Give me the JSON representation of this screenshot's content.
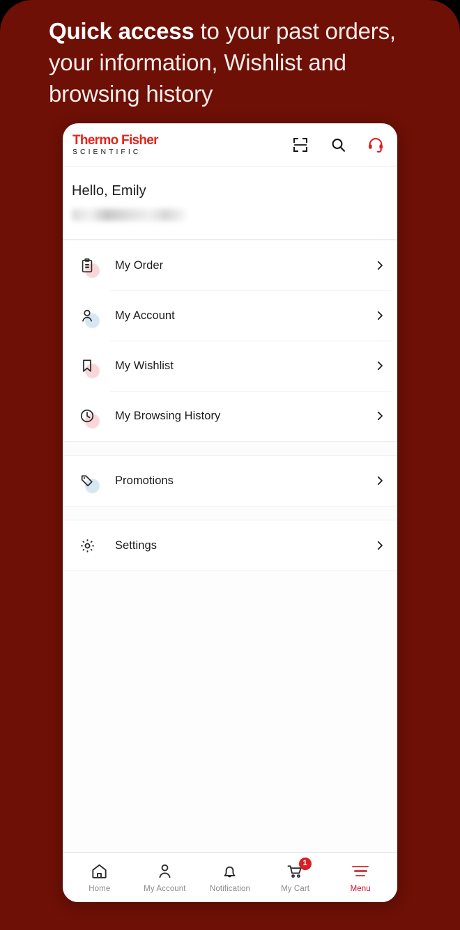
{
  "promo": {
    "headline_bold": "Quick access",
    "headline_rest": " to your past orders, your information, Wishlist and browsing history",
    "background_color": "#6E1006"
  },
  "app": {
    "header": {
      "brand_top": "Thermo Fisher",
      "brand_bottom": "SCIENTIFIC",
      "brand_color": "#E1251B",
      "actions": [
        {
          "name": "scan-icon",
          "label": "Scan"
        },
        {
          "name": "search-icon",
          "label": "Search"
        },
        {
          "name": "headset-icon",
          "label": "Support"
        }
      ]
    },
    "greeting": {
      "salutation": "Hello, Emily",
      "email_redacted": true
    },
    "menu_groups": [
      {
        "items": [
          {
            "label": "My Order",
            "icon": "clipboard-icon",
            "tint": "#F8D6D9"
          },
          {
            "label": "My Account",
            "icon": "person-icon",
            "tint": "#D6E7F2"
          },
          {
            "label": "My Wishlist",
            "icon": "bookmark-icon",
            "tint": "#F8D6D9"
          },
          {
            "label": "My Browsing History",
            "icon": "clock-icon",
            "tint": "#F8D6D9"
          }
        ]
      },
      {
        "items": [
          {
            "label": "Promotions",
            "icon": "tag-icon",
            "tint": "#D6E7F2"
          }
        ]
      },
      {
        "items": [
          {
            "label": "Settings",
            "icon": "gear-icon",
            "tint": "#FFFFFF"
          }
        ]
      }
    ],
    "bottom_nav": {
      "active_color": "#C8102E",
      "inactive_color": "#8A8A8A",
      "items": [
        {
          "label": "Home",
          "icon": "home-icon",
          "active": false,
          "badge": null
        },
        {
          "label": "My Account",
          "icon": "person-icon",
          "active": false,
          "badge": null
        },
        {
          "label": "Notification",
          "icon": "bell-icon",
          "active": false,
          "badge": null
        },
        {
          "label": "My Cart",
          "icon": "cart-icon",
          "active": false,
          "badge": "1"
        },
        {
          "label": "Menu",
          "icon": "hamburger-icon",
          "active": true,
          "badge": null
        }
      ]
    }
  }
}
